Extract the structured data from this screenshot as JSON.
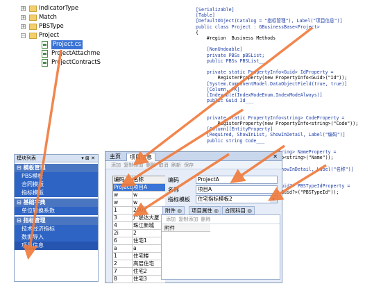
{
  "tree": {
    "items": [
      {
        "label": "IndicatorType",
        "type": "folder",
        "expand": "+"
      },
      {
        "label": "Match",
        "type": "folder",
        "expand": "+"
      },
      {
        "label": "PBSType",
        "type": "folder",
        "expand": "+"
      },
      {
        "label": "Project",
        "type": "folder",
        "expand": "−"
      },
      {
        "label": "Project.cs",
        "type": "file",
        "selected": true
      },
      {
        "label": "ProjectAttachme",
        "type": "file"
      },
      {
        "label": "ProjectContractS",
        "type": "file"
      }
    ]
  },
  "code": [
    {
      "t": "[Serializable]",
      "k": "c"
    },
    {
      "t": "[Table]",
      "k": "c"
    },
    {
      "t": "[DefaultObject(Catalog = \"指标管理\"), Label(\"项目信息\")]",
      "k": "c"
    },
    {
      "t": "public class Project : GBusinessBase<Project>",
      "k": "c"
    },
    {
      "t": "{",
      "k": ""
    },
    {
      "t": "    #region  Business Methods",
      "k": ""
    },
    {
      "t": "",
      "k": ""
    },
    {
      "t": "    [NonUndoable]",
      "k": "c"
    },
    {
      "t": "    private PBSs pBSList;",
      "k": "c"
    },
    {
      "t": "    public PBSs PBSList___",
      "k": "c"
    },
    {
      "t": "",
      "k": ""
    },
    {
      "t": "    private static PropertyInfo<Guid> IdProperty =",
      "k": "c"
    },
    {
      "t": "        RegisterProperty(new PropertyInfo<Guid>(\"Id\"));",
      "k": ""
    },
    {
      "t": "    [System.ComponentModel.DataObjectField(true, true)]",
      "k": "c"
    },
    {
      "t": "    [Column, PK]",
      "k": "c"
    },
    {
      "t": "    [Indexable(IndexModeEnum.IndexModeAlways)]",
      "k": "c"
    },
    {
      "t": "    public Guid Id___",
      "k": "c"
    },
    {
      "t": "",
      "k": ""
    },
    {
      "t": "",
      "k": ""
    },
    {
      "t": "    private static PropertyInfo<string> CodeProperty =",
      "k": "c"
    },
    {
      "t": "        RegisterProperty(new PropertyInfo<string>(\"Code\"));",
      "k": ""
    },
    {
      "t": "    [Column][EntityProperty]",
      "k": "c"
    },
    {
      "t": "    [Required, ShowInList, ShowInDetail, Label(\"编码\")]",
      "k": "c"
    },
    {
      "t": "    public string Code___",
      "k": "c"
    },
    {
      "t": "",
      "k": ""
    },
    {
      "t": "                            <string> NameProperty =",
      "k": "c"
    },
    {
      "t": "                            Info<string>(\"Name\"));",
      "k": ""
    },
    {
      "t": "",
      "k": ""
    },
    {
      "t": "                            , ShowInDetail, Label(\"名称\")]",
      "k": "c"
    },
    {
      "t": "",
      "k": ""
    },
    {
      "t": "",
      "k": ""
    },
    {
      "t": "                            o<Guid?> PBSTypeIdProperty =",
      "k": "c"
    },
    {
      "t": "                            fo<Guid?>(\"PBSTypeId\"));",
      "k": ""
    }
  ],
  "left_panel": {
    "title": "模块列表",
    "title_controls": "▾ ⊠ ✕",
    "groups": [
      {
        "label": "模板管理",
        "items": [
          "PBS模板",
          "合同模板",
          "指标模板"
        ]
      },
      {
        "label": "基础字典",
        "items": [
          "单位转换系数"
        ]
      },
      {
        "label": "指标管理",
        "items": [
          "技术经济指标",
          "数据导入",
          "项目信息"
        ]
      }
    ]
  },
  "main_window": {
    "tabs": [
      "主页",
      "项目信息"
    ],
    "close": "✕",
    "toolbar": "添加 复制添加 删除 取消 刷新 保存",
    "grid_headers": [
      "编码",
      "名称"
    ],
    "grid_rows": [
      [
        "ProjectA",
        "项目A"
      ],
      [
        "w",
        "w"
      ],
      [
        "w",
        "w"
      ],
      [
        "1",
        "2008"
      ],
      [
        "3",
        "广联达大厦"
      ],
      [
        "4",
        "珠江新城"
      ],
      [
        "2i",
        "2"
      ],
      [
        "6",
        "住宅1"
      ],
      [
        "a",
        "a"
      ],
      [
        "1",
        "住宅楼"
      ],
      [
        "2",
        "高层住宅"
      ],
      [
        "7",
        "住宅2"
      ],
      [
        "8",
        "住宅3"
      ]
    ],
    "form": [
      {
        "label": "编码",
        "value": "ProjectA"
      },
      {
        "label": "名称",
        "value": "项目A"
      },
      {
        "label": "指标模板",
        "value": "住宅指标模板2",
        "dropdown": "▾"
      }
    ],
    "sub_tabs": [
      "附件",
      "项目属性",
      "合同科目"
    ],
    "sub_toolbar": "添加 复制添加 删除",
    "sub_header": "附件"
  },
  "colors": {
    "arrow": "#f07a3a",
    "accent": "#3a74d6"
  }
}
